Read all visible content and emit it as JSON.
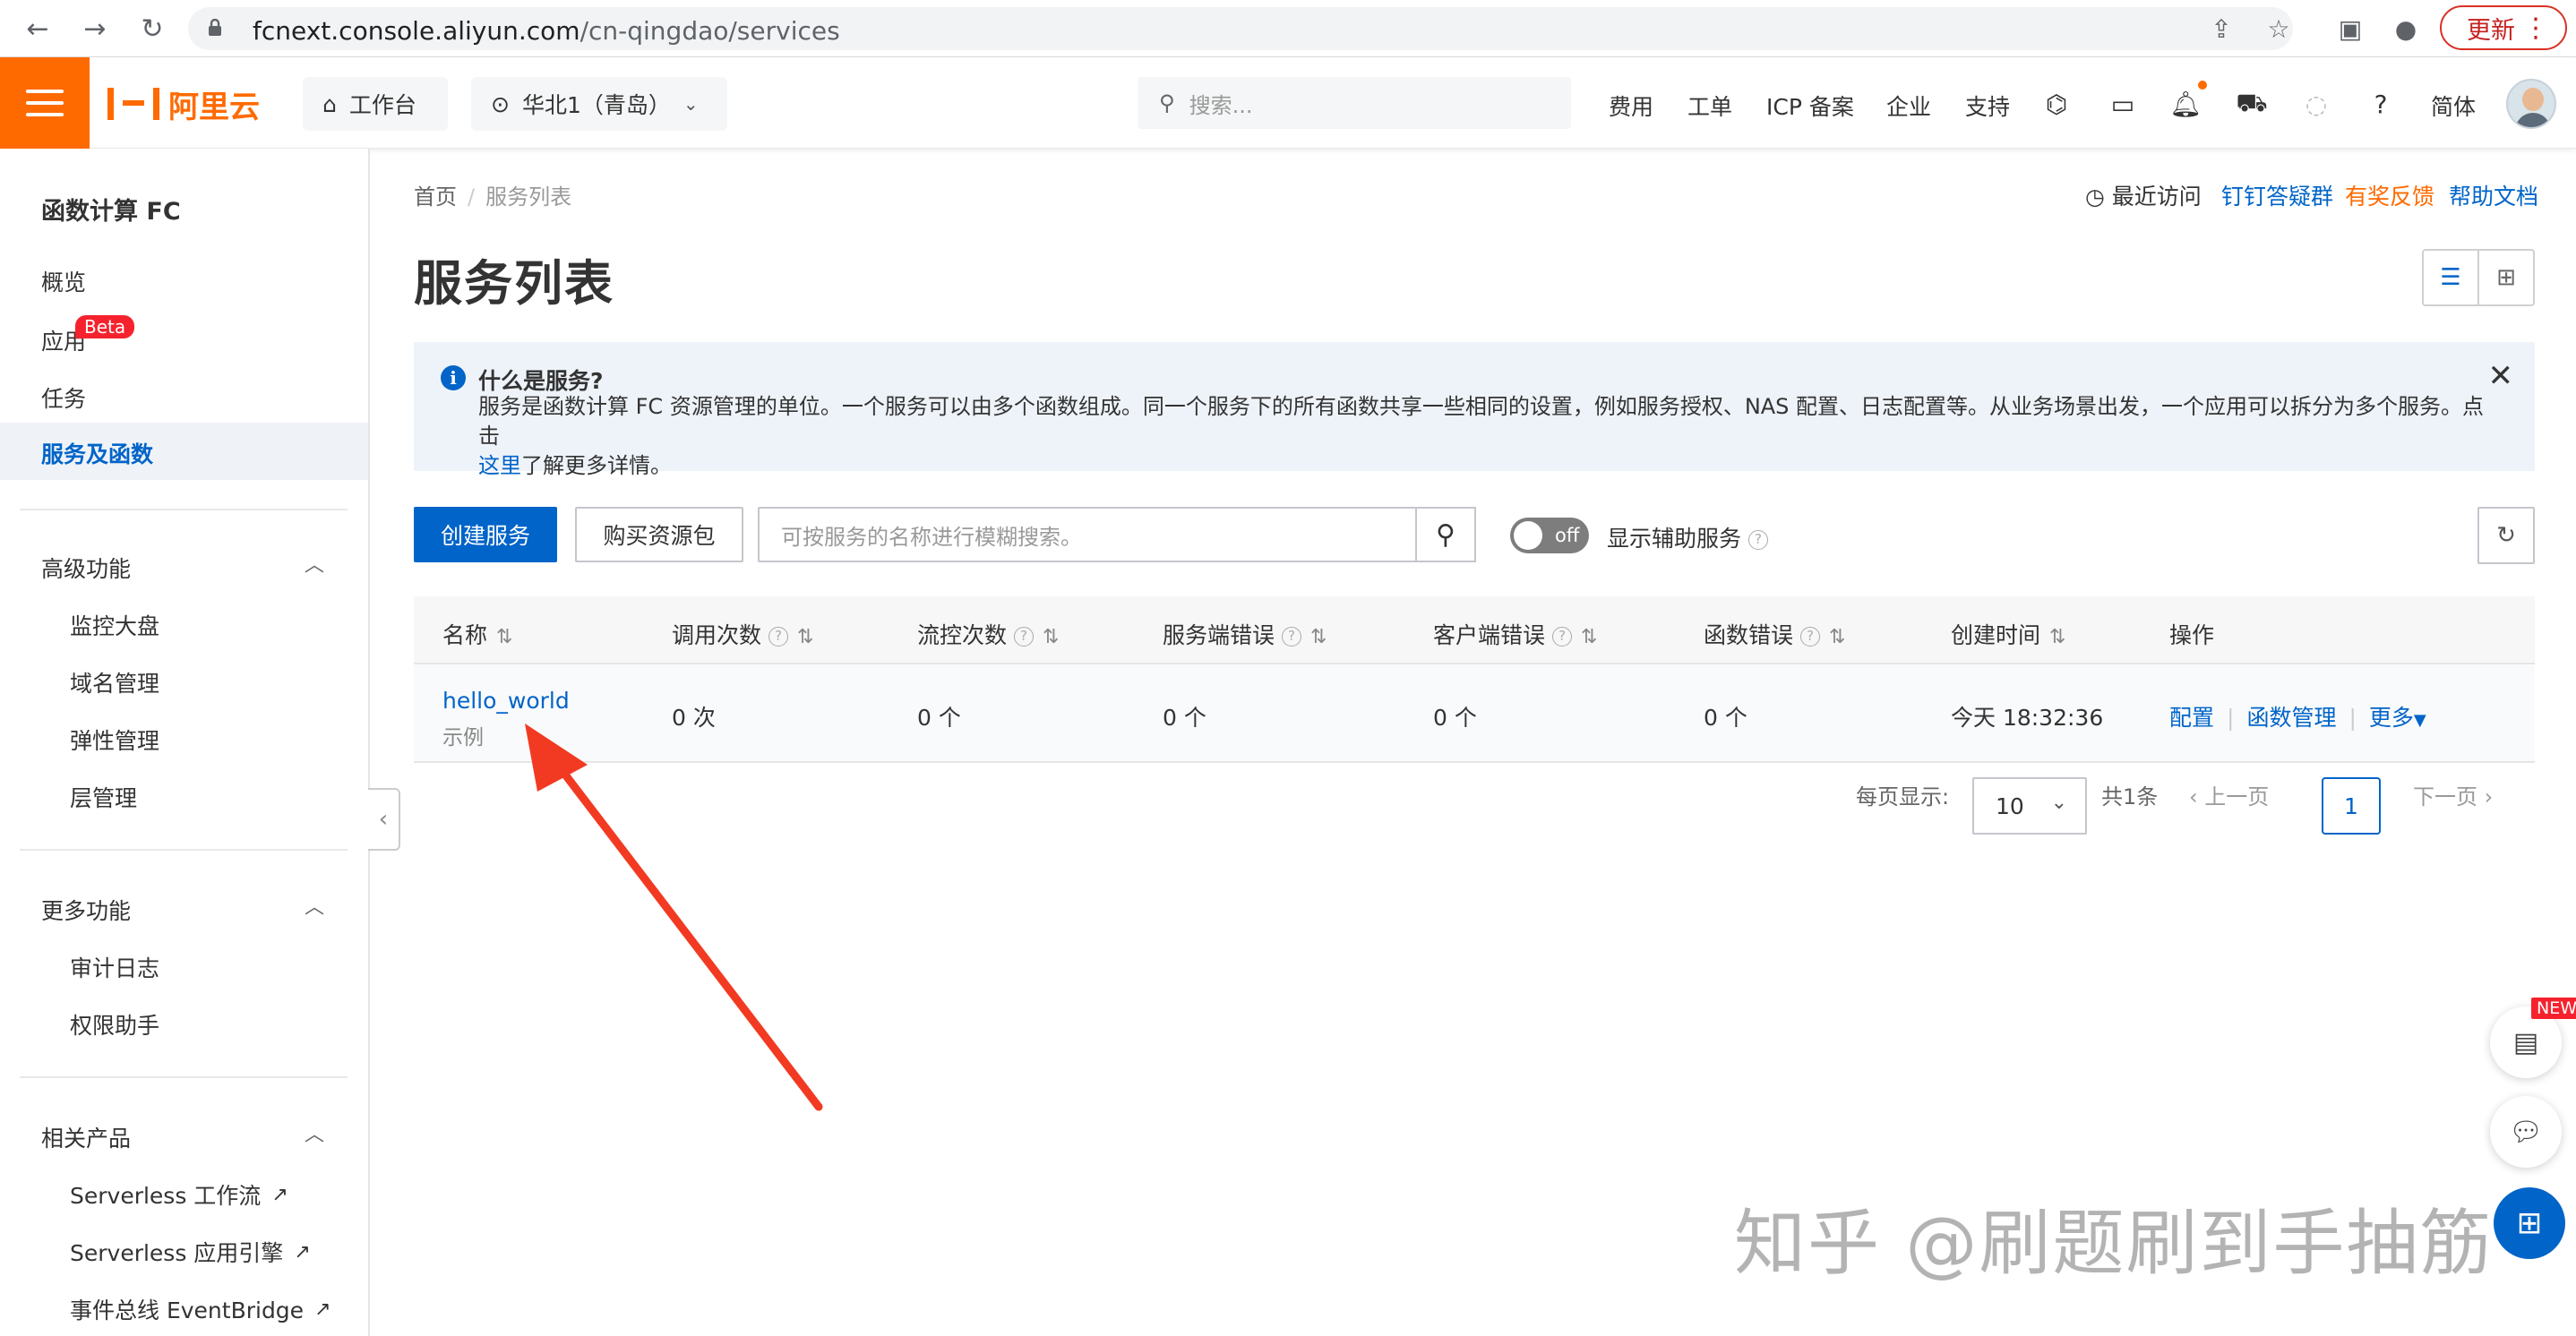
{
  "browser": {
    "url_host": "fcnext.console.aliyun.com",
    "url_path": "/cn-qingdao/services",
    "update_label": "更新"
  },
  "topnav": {
    "logo": "阿里云",
    "workbench": "工作台",
    "region": "华北1（青岛）",
    "search_placeholder": "搜索...",
    "items": [
      "费用",
      "工单",
      "ICP 备案",
      "企业",
      "支持"
    ],
    "lang": "简体"
  },
  "sidebar": {
    "title": "函数计算 FC",
    "items": [
      "概览",
      "应用",
      "任务",
      "服务及函数"
    ],
    "beta_badge": "Beta",
    "active": "服务及函数",
    "groups": [
      {
        "title": "高级功能",
        "items": [
          "监控大盘",
          "域名管理",
          "弹性管理",
          "层管理"
        ]
      },
      {
        "title": "更多功能",
        "items": [
          "审计日志",
          "权限助手"
        ]
      },
      {
        "title": "相关产品",
        "items": [
          "Serverless 工作流",
          "Serverless 应用引擎",
          "事件总线 EventBridge"
        ]
      }
    ]
  },
  "breadcrumb": {
    "home": "首页",
    "current": "服务列表"
  },
  "top_links": {
    "recent": "最近访问",
    "dingtalk": "钉钉答疑群",
    "feedback": "有奖反馈",
    "docs": "帮助文档"
  },
  "page_title": "服务列表",
  "notice": {
    "title": "什么是服务?",
    "body": "服务是函数计算 FC 资源管理的单位。一个服务可以由多个函数组成。同一个服务下的所有函数共享一些相同的设置，例如服务授权、NAS 配置、日志配置等。从业务场景出发，一个应用可以拆分为多个服务。点击",
    "link": "这里",
    "tail": "了解更多详情。"
  },
  "toolbar": {
    "create": "创建服务",
    "buy": "购买资源包",
    "search_placeholder": "可按服务的名称进行模糊搜索。",
    "toggle_state": "off",
    "toggle_label": "显示辅助服务"
  },
  "table": {
    "headers": [
      "名称",
      "调用次数",
      "流控次数",
      "服务端错误",
      "客户端错误",
      "函数错误",
      "创建时间",
      "操作"
    ],
    "rows": [
      {
        "name": "hello_world",
        "desc": "示例",
        "calls": "0 次",
        "throttles": "0 个",
        "server_errors": "0 个",
        "client_errors": "0 个",
        "function_errors": "0 个",
        "created": "今天 18:32:36",
        "ops": [
          "配置",
          "函数管理",
          "更多"
        ]
      }
    ]
  },
  "pagination": {
    "per_page_label": "每页显示:",
    "per_page": "10",
    "total": "共1条",
    "prev": "上一页",
    "current": "1",
    "next": "下一页"
  },
  "float": {
    "new_tag": "NEW"
  },
  "watermark": "知乎 @刷题刷到手抽筋",
  "colors": {
    "brand": "#ff6a00",
    "primary": "#0064c8",
    "annotation_arrow": "#f23a22"
  }
}
